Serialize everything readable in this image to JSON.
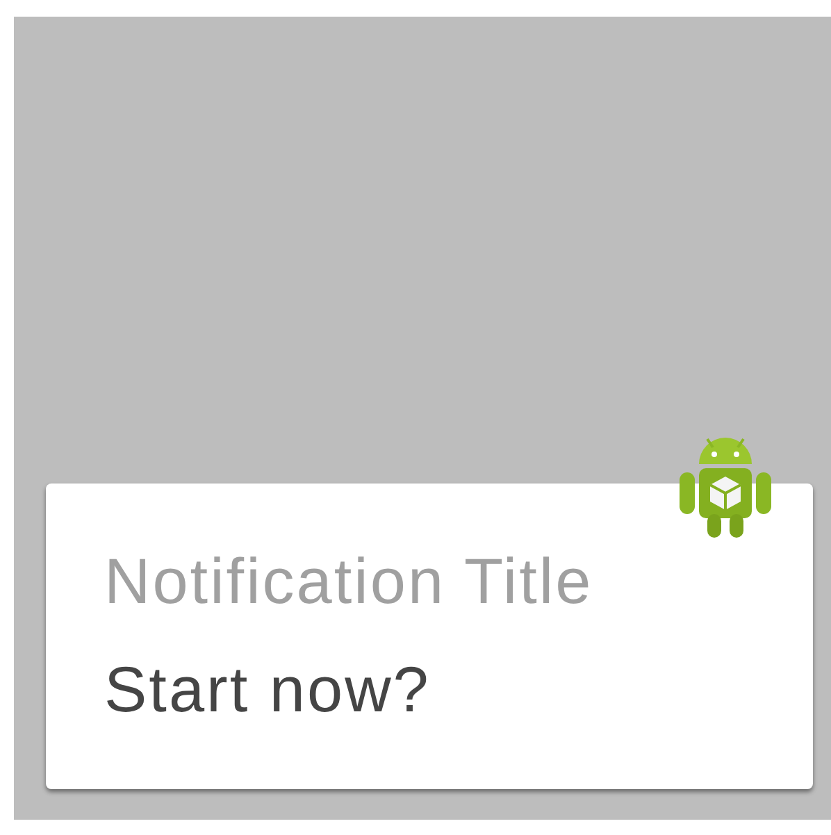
{
  "notification": {
    "title": "Notification Title",
    "text": "Start now?"
  }
}
